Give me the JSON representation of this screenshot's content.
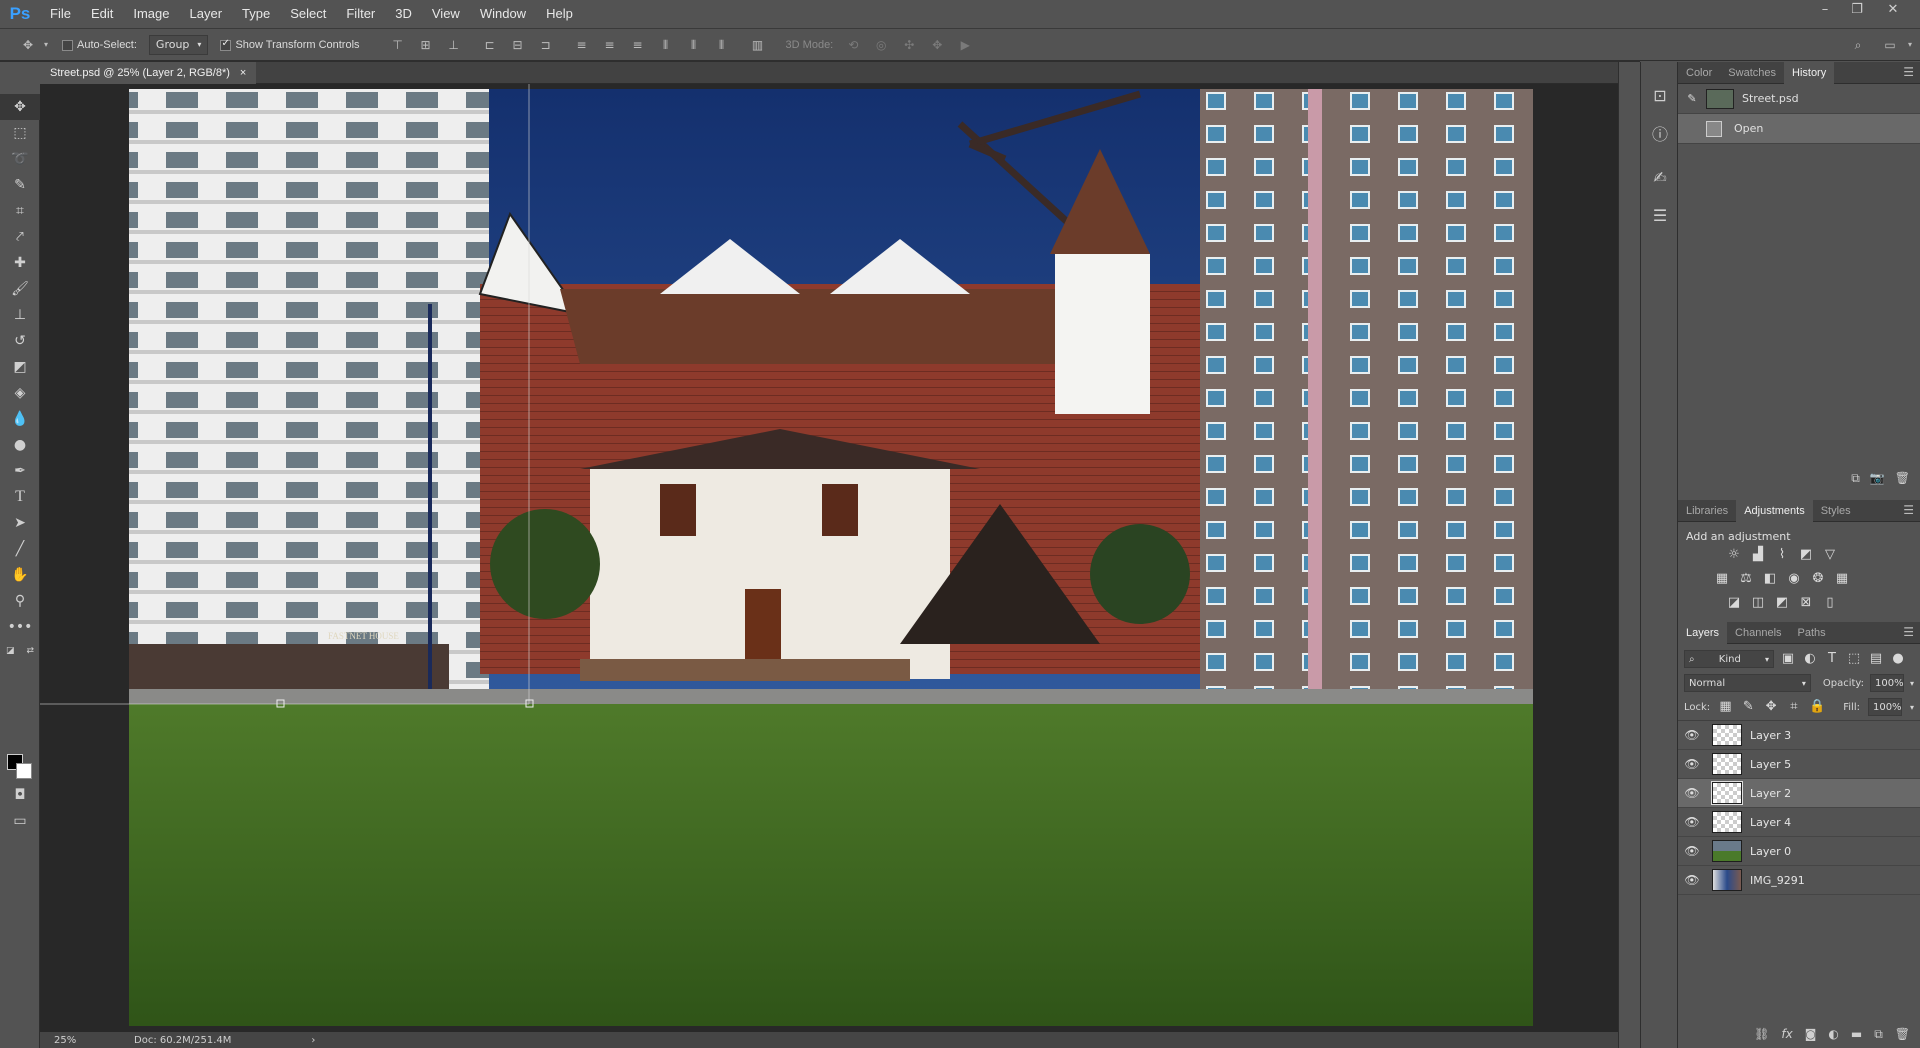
{
  "app": {
    "logo": "Ps"
  },
  "menu": [
    "File",
    "Edit",
    "Image",
    "Layer",
    "Type",
    "Select",
    "Filter",
    "3D",
    "View",
    "Window",
    "Help"
  ],
  "window_controls": {
    "minimize": "–",
    "restore": "❐",
    "close": "✕"
  },
  "options": {
    "auto_select_label": "Auto-Select:",
    "auto_select_checked": false,
    "auto_select_target": "Group",
    "show_transform_label": "Show Transform Controls",
    "show_transform_checked": true,
    "mode_3d_label": "3D Mode:"
  },
  "document": {
    "tab_title": "Street.psd @ 25% (Layer 2, RGB/8*)",
    "close_glyph": "×",
    "zoom": "25%",
    "doc_size": "Doc: 60.2M/251.4M",
    "status_arrow": "›",
    "sign_text": "FASTNET HOUSE"
  },
  "panels": {
    "top_tabs": [
      "Color",
      "Swatches",
      "History"
    ],
    "top_active": "History",
    "history": [
      {
        "label": "Street.psd",
        "type": "snapshot"
      },
      {
        "label": "Open",
        "type": "state"
      }
    ],
    "mid_tabs": [
      "Libraries",
      "Adjustments",
      "Styles"
    ],
    "mid_active": "Adjustments",
    "adjustments_title": "Add an adjustment",
    "layer_tabs": [
      "Layers",
      "Channels",
      "Paths"
    ],
    "layer_active": "Layers",
    "filter_kind": "Kind",
    "blend_mode": "Normal",
    "opacity_label": "Opacity:",
    "opacity_value": "100%",
    "lock_label": "Lock:",
    "fill_label": "Fill:",
    "fill_value": "100%",
    "layers": [
      {
        "name": "Layer 3",
        "visible": true,
        "selected": false
      },
      {
        "name": "Layer 5",
        "visible": true,
        "selected": false
      },
      {
        "name": "Layer 2",
        "visible": true,
        "selected": true
      },
      {
        "name": "Layer 4",
        "visible": true,
        "selected": false
      },
      {
        "name": "Layer 0",
        "visible": true,
        "selected": false
      },
      {
        "name": "IMG_9291",
        "visible": true,
        "selected": false
      }
    ]
  },
  "colors": {
    "foreground": "#000000",
    "background": "#ffffff",
    "accent": "#3aa0ff"
  }
}
